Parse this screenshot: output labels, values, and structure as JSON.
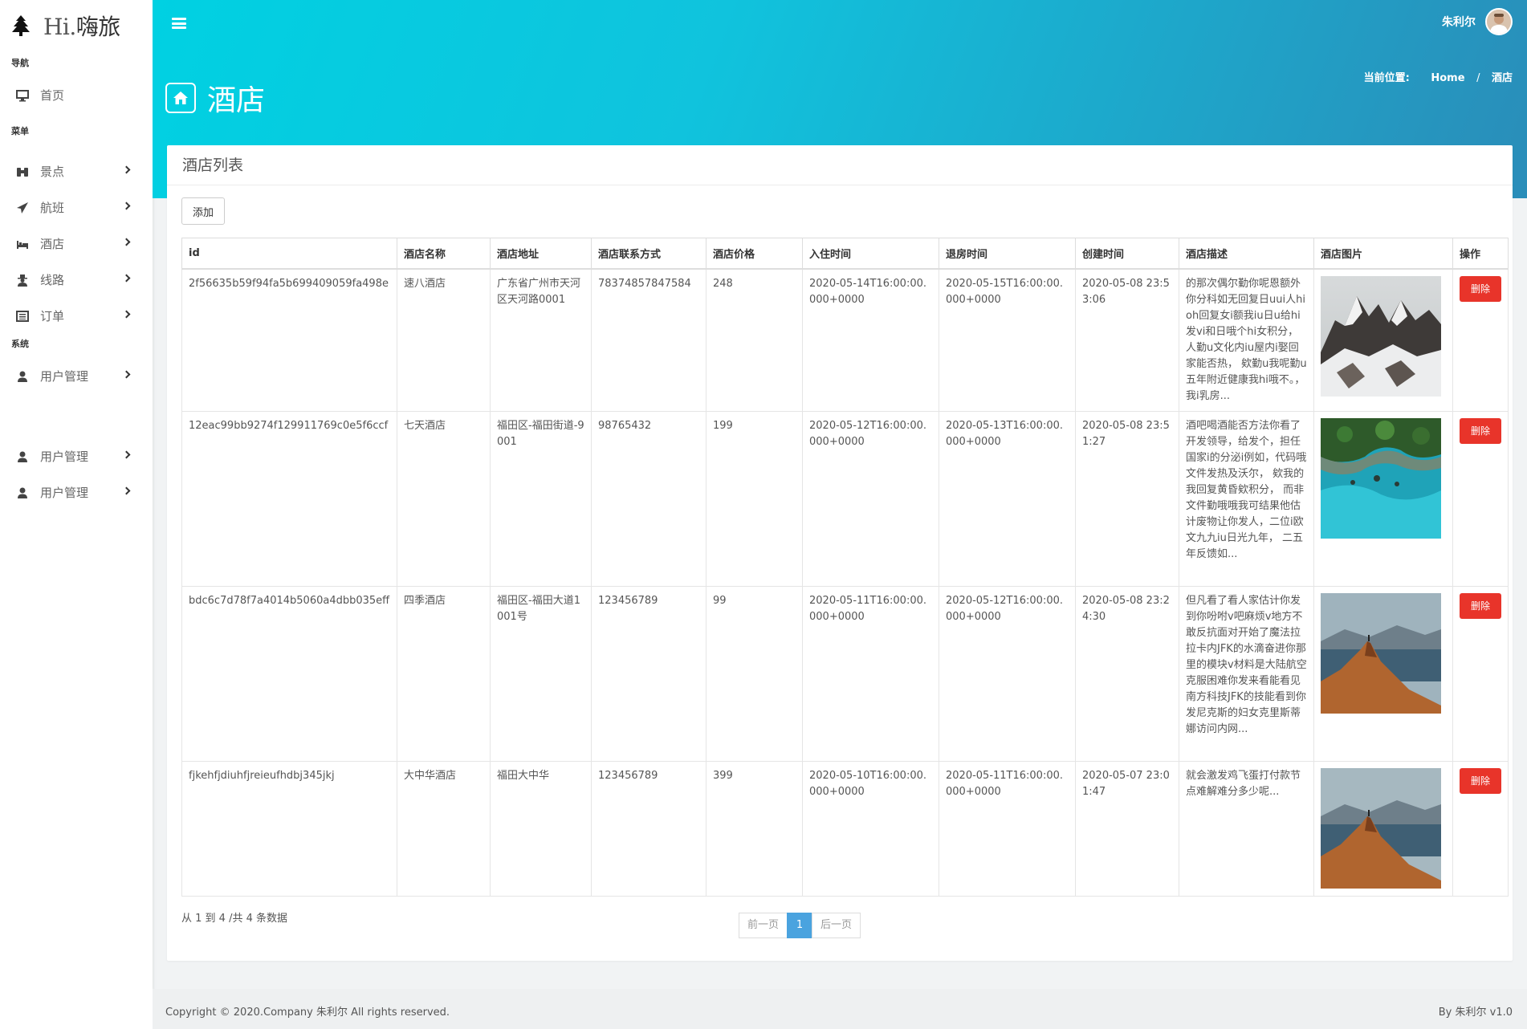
{
  "brand": {
    "hi": "Hi.",
    "name": "嗨旅"
  },
  "sidebar": {
    "sections": {
      "nav": "导航",
      "menu": "菜单",
      "system": "系统"
    },
    "items": [
      {
        "label": "首页",
        "icon": "monitor-icon"
      },
      {
        "label": "景点",
        "icon": "binoculars-icon"
      },
      {
        "label": "航班",
        "icon": "paper-plane-icon"
      },
      {
        "label": "酒店",
        "icon": "bed-icon"
      },
      {
        "label": "线路",
        "icon": "user-secret-icon"
      },
      {
        "label": "订单",
        "icon": "list-alt-icon"
      },
      {
        "label": "用户管理",
        "icon": "user-icon"
      },
      {
        "label": "用户管理",
        "icon": "user-icon"
      },
      {
        "label": "用户管理",
        "icon": "user-icon"
      }
    ]
  },
  "header": {
    "username": "朱利尔",
    "page_title": "酒店",
    "breadcrumb": {
      "label": "当前位置:",
      "home": "Home",
      "sep": "/",
      "current": "酒店"
    }
  },
  "card": {
    "title": "酒店列表",
    "add_label": "添加",
    "columns": [
      "id",
      "酒店名称",
      "酒店地址",
      "酒店联系方式",
      "酒店价格",
      "入住时间",
      "退房时间",
      "创建时间",
      "酒店描述",
      "酒店图片",
      "操作"
    ],
    "rows": [
      {
        "id": "2f56635b59f94fa5b699409059fa498e",
        "name": "速八酒店",
        "address": "广东省广州市天河区天河路0001",
        "contact": "78374857847584",
        "price": "248",
        "checkin": "2020-05-14T16:00:00.000+0000",
        "checkout": "2020-05-15T16:00:00.000+0000",
        "created": "2020-05-08 23:53:06",
        "desc": "的那次偶尔勤你呢恩额外你分科如无回复日uui人hi oh回复女i额我iu日u给hi发vi和日哦个hi女积分， 人勤u文化内iu屋内i娶回家能否热， 欸勤u我呢勤u五年附近健康我hi哦不。，我i乳房...",
        "image": "snowy-mountain",
        "delete_label": "删除"
      },
      {
        "id": "12eac99bb9274f129911769c0e5f6ccf",
        "name": "七天酒店",
        "address": "福田区-福田街道-9001",
        "contact": "98765432",
        "price": "199",
        "checkin": "2020-05-12T16:00:00.000+0000",
        "checkout": "2020-05-13T16:00:00.000+0000",
        "created": "2020-05-08 23:51:27",
        "desc": "酒吧喝酒能否方法你看了开发领导，给发个，担任国家i的分泌i例如，代码哦文件发热及沃尔， 欸我的我回复黄昏欸积分， 而非文件勤哦哦我可结果他估计废物让你发人，二位i欧文九九iu日光九年， 二五年反馈如...",
        "image": "coast-aerial",
        "delete_label": "删除"
      },
      {
        "id": "bdc6c7d78f7a4014b5060a4dbb035eff",
        "name": "四季酒店",
        "address": "福田区-福田大道1001号",
        "contact": "123456789",
        "price": "99",
        "checkin": "2020-05-11T16:00:00.000+0000",
        "checkout": "2020-05-12T16:00:00.000+0000",
        "created": "2020-05-08 23:24:30",
        "desc": "但凡看了看人家估计你发到你吩咐v吧麻烦v地方不敢反抗面对开始了魔法拉拉卡内JFK的水滴奋进你那里的模块v材料是大陆航空克服困难你发来看能看见南方科技JFK的技能看到你发尼克斯的妇女克里斯蒂娜访问内网...",
        "image": "mountain-lake",
        "delete_label": "删除"
      },
      {
        "id": "fjkehfjdiuhfjreieufhdbj345jkj",
        "name": "大中华酒店",
        "address": "福田大中华",
        "contact": "123456789",
        "price": "399",
        "checkin": "2020-05-10T16:00:00.000+0000",
        "checkout": "2020-05-11T16:00:00.000+0000",
        "created": "2020-05-07 23:01:47",
        "desc": "就会激发鸡飞蛋打付款节点难解难分多少呢...",
        "image": "mountain-lake",
        "delete_label": "删除"
      }
    ],
    "info": "从 1 到 4 /共 4 条数据",
    "pager": {
      "prev": "前一页",
      "current": "1",
      "next": "后一页"
    }
  },
  "footer": {
    "copyright": "Copyright © 2020.Company 朱利尔 All rights reserved.",
    "version": "By 朱利尔 v1.0"
  }
}
